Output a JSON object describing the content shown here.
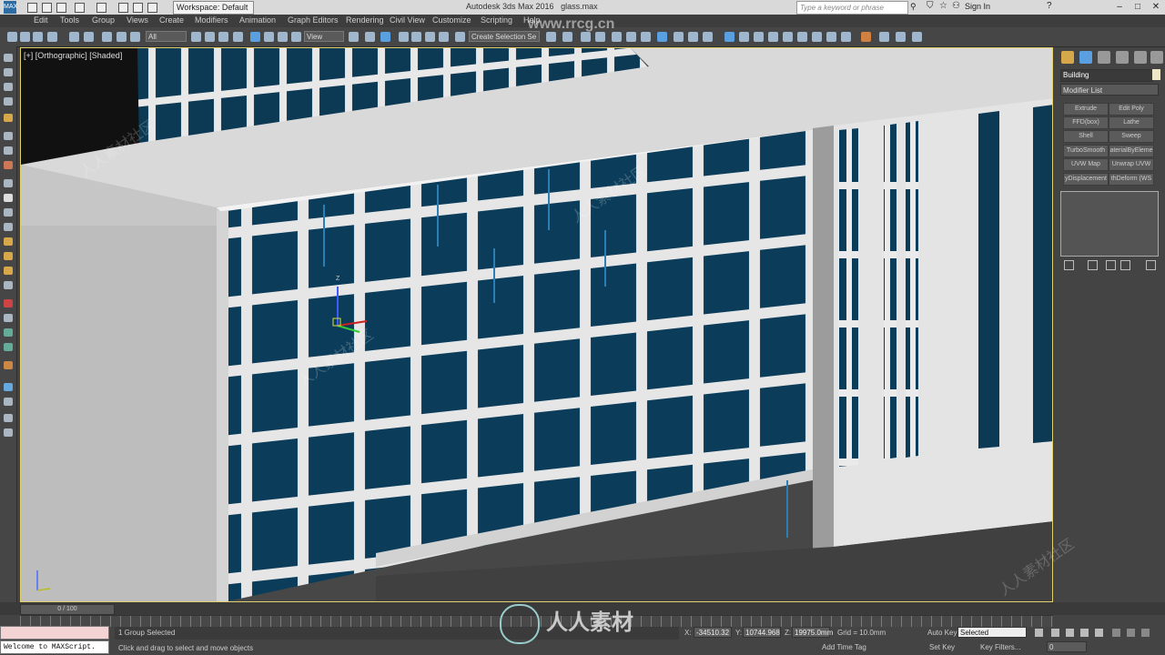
{
  "titlebar": {
    "logo": "MAX",
    "workspace": "Workspace: Default",
    "title": "Autodesk 3ds Max 2016",
    "file": "glass.max",
    "search_placeholder": "Type a keyword or phrase",
    "signin": "Sign In",
    "help": "?"
  },
  "menu": [
    "Edit",
    "Tools",
    "Group",
    "Views",
    "Create",
    "Modifiers",
    "Animation",
    "Graph Editors",
    "Rendering",
    "Civil View",
    "Customize",
    "Scripting",
    "Help"
  ],
  "toolbar": {
    "filter": "All",
    "refcoord": "View",
    "selection_set": "Create Selection Se"
  },
  "viewport": {
    "label": "[+] [Orthographic] [Shaded]",
    "gizmo_axis": "Z"
  },
  "command_panel": {
    "object_name": "Building",
    "modifier_list": "Modifier List",
    "modifier_buttons": [
      "Extrude",
      "Edit Poly",
      "FFD(box)",
      "Lathe",
      "Shell",
      "Sweep",
      "TurboSmooth",
      "aterialByEleme",
      "UVW Map",
      "Unwrap UVW",
      "yDisplacement",
      "thDeform (WS"
    ]
  },
  "bottom": {
    "time_slider": "0 / 100",
    "maxscript_listener": "Welcome to MAXScript.",
    "status": "1 Group Selected",
    "prompt": "Click and drag to select and move objects",
    "x_label": "X:",
    "x_value": "-34510.32",
    "y_label": "Y:",
    "y_value": "10744.968",
    "z_label": "Z:",
    "z_value": "19975.0mm",
    "grid": "Grid = 10.0mm",
    "add_time_tag": "Add Time Tag",
    "auto_key": "Auto Key",
    "key_mode": "Selected",
    "set_key": "Set Key",
    "key_filters": "Key Filters...",
    "frame": "0"
  },
  "watermark": {
    "text": "人人素材",
    "repeat_text": "人人素材社区",
    "url": "www.rrcg.cn"
  },
  "colors": {
    "glass": "#0b3d5a",
    "glass_hi": "#2b7fb5",
    "concrete": "#e3e3e3",
    "viewport_border": "#e2d06f"
  }
}
